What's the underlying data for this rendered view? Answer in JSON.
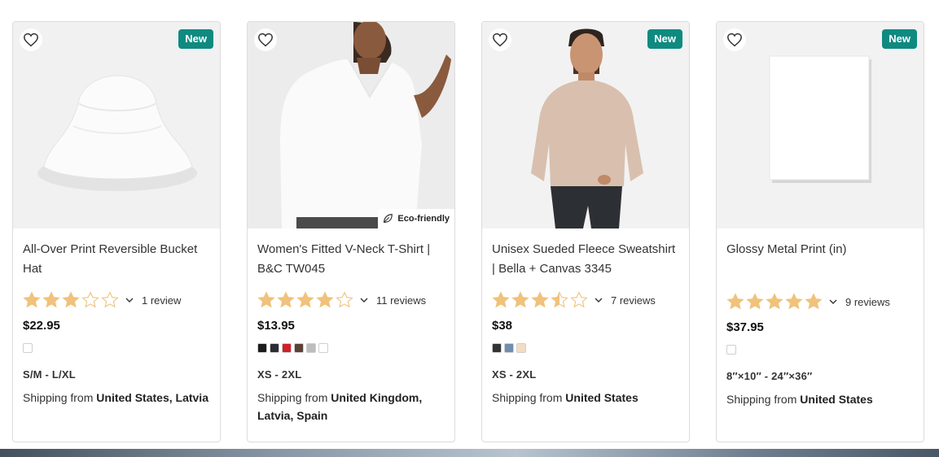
{
  "products": [
    {
      "title": "All-Over Print Reversible Bucket Hat",
      "badge": "New",
      "eco": "",
      "rating": 3,
      "reviews": "1 review",
      "price": "$22.95",
      "swatches": [
        "#ffffff"
      ],
      "sizes": "S/M - L/XL",
      "shipping_prefix": "Shipping from",
      "shipping_from": "United States, Latvia"
    },
    {
      "title": "Women's Fitted V-Neck T-Shirt | B&C TW045",
      "badge": "",
      "eco": "Eco-friendly",
      "rating": 4,
      "reviews": "11 reviews",
      "price": "$13.95",
      "swatches": [
        "#1c1c1c",
        "#2b2d33",
        "#d0202a",
        "#5a4236",
        "#bdbdbd",
        "#ffffff"
      ],
      "sizes": "XS - 2XL",
      "shipping_prefix": "Shipping from",
      "shipping_from": "United Kingdom, Latvia, Spain"
    },
    {
      "title": "Unisex Sueded Fleece Sweatshirt | Bella + Canvas 3345",
      "badge": "New",
      "eco": "",
      "rating": 3.5,
      "reviews": "7 reviews",
      "price": "$38",
      "swatches": [
        "#333333",
        "#6f8eb0",
        "#f3dcc4"
      ],
      "sizes": "XS - 2XL",
      "shipping_prefix": "Shipping from",
      "shipping_from": "United States"
    },
    {
      "title": "Glossy Metal Print (in)",
      "badge": "New",
      "eco": "",
      "rating": 5,
      "reviews": "9 reviews",
      "price": "$37.95",
      "swatches": [
        "#ffffff"
      ],
      "sizes": "8″×10″ - 24″×36″",
      "shipping_prefix": "Shipping from",
      "shipping_from": "United States"
    }
  ],
  "colors": {
    "badge": "#0f8a81",
    "star": "#f0c27b",
    "star_empty": "#d8d8d8"
  }
}
